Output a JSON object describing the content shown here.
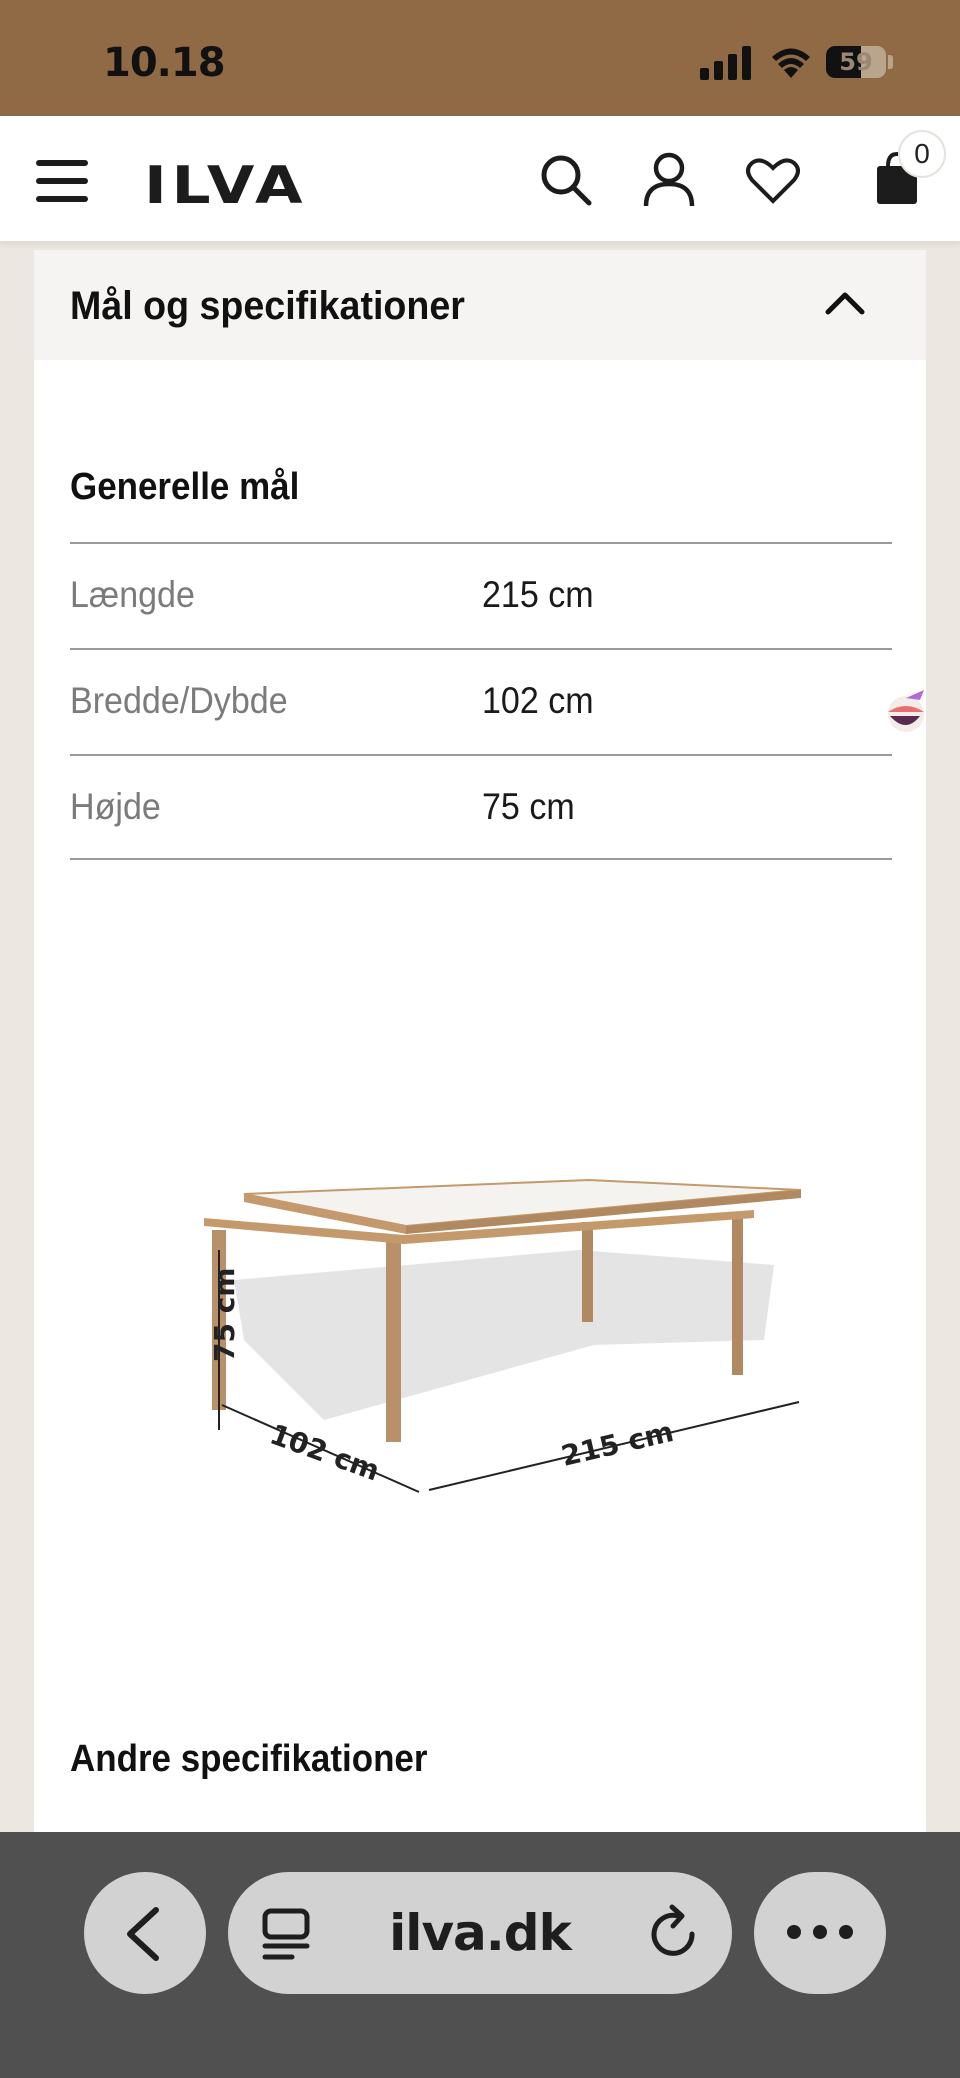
{
  "status_bar": {
    "time": "10.18",
    "battery": "59",
    "battery_fraction": 0.59
  },
  "header": {
    "logo": "ILVA",
    "cart_count": "0"
  },
  "accordion": {
    "title": "Mål og specifikationer"
  },
  "general": {
    "heading": "Generelle mål",
    "rows": [
      {
        "label": "Længde",
        "value": "215 cm"
      },
      {
        "label": "Bredde/Dybde",
        "value": "102 cm"
      },
      {
        "label": "Højde",
        "value": "75 cm"
      }
    ]
  },
  "illustration": {
    "height_label": "75 cm",
    "depth_label": "102 cm",
    "length_label": "215 cm"
  },
  "other": {
    "heading": "Andre specifikationer"
  },
  "browser": {
    "url": "ilva.dk"
  }
}
